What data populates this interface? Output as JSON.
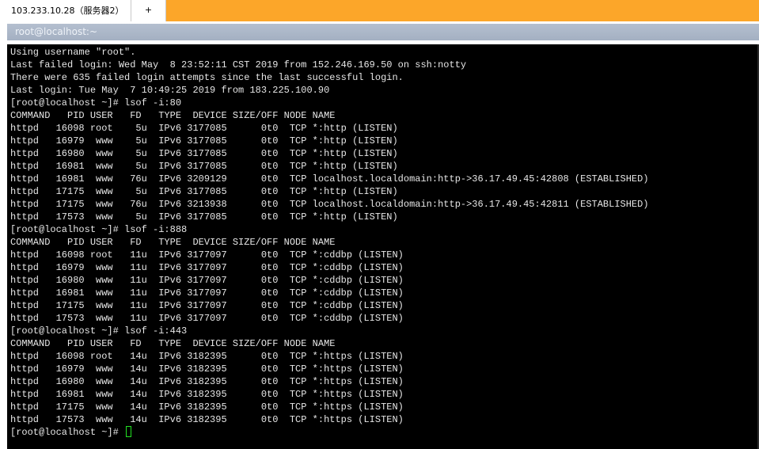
{
  "tabs": {
    "active_label": "103.233.10.28（服务器2）",
    "new_tab_label": "+"
  },
  "window": {
    "title": "root@localhost:~"
  },
  "terminal": {
    "lines": [
      "Using username \"root\".",
      "Last failed login: Wed May  8 23:52:11 CST 2019 from 152.246.169.50 on ssh:notty",
      "There were 635 failed login attempts since the last successful login.",
      "Last login: Tue May  7 10:49:25 2019 from 183.225.100.90",
      "[root@localhost ~]# lsof -i:80",
      "COMMAND   PID USER   FD   TYPE  DEVICE SIZE/OFF NODE NAME",
      "httpd   16098 root    5u  IPv6 3177085      0t0  TCP *:http (LISTEN)",
      "httpd   16979  www    5u  IPv6 3177085      0t0  TCP *:http (LISTEN)",
      "httpd   16980  www    5u  IPv6 3177085      0t0  TCP *:http (LISTEN)",
      "httpd   16981  www    5u  IPv6 3177085      0t0  TCP *:http (LISTEN)",
      "httpd   16981  www   76u  IPv6 3209129      0t0  TCP localhost.localdomain:http->36.17.49.45:42808 (ESTABLISHED)",
      "httpd   17175  www    5u  IPv6 3177085      0t0  TCP *:http (LISTEN)",
      "httpd   17175  www   76u  IPv6 3213938      0t0  TCP localhost.localdomain:http->36.17.49.45:42811 (ESTABLISHED)",
      "httpd   17573  www    5u  IPv6 3177085      0t0  TCP *:http (LISTEN)",
      "[root@localhost ~]# lsof -i:888",
      "COMMAND   PID USER   FD   TYPE  DEVICE SIZE/OFF NODE NAME",
      "httpd   16098 root   11u  IPv6 3177097      0t0  TCP *:cddbp (LISTEN)",
      "httpd   16979  www   11u  IPv6 3177097      0t0  TCP *:cddbp (LISTEN)",
      "httpd   16980  www   11u  IPv6 3177097      0t0  TCP *:cddbp (LISTEN)",
      "httpd   16981  www   11u  IPv6 3177097      0t0  TCP *:cddbp (LISTEN)",
      "httpd   17175  www   11u  IPv6 3177097      0t0  TCP *:cddbp (LISTEN)",
      "httpd   17573  www   11u  IPv6 3177097      0t0  TCP *:cddbp (LISTEN)",
      "[root@localhost ~]# lsof -i:443",
      "COMMAND   PID USER   FD   TYPE  DEVICE SIZE/OFF NODE NAME",
      "httpd   16098 root   14u  IPv6 3182395      0t0  TCP *:https (LISTEN)",
      "httpd   16979  www   14u  IPv6 3182395      0t0  TCP *:https (LISTEN)",
      "httpd   16980  www   14u  IPv6 3182395      0t0  TCP *:https (LISTEN)",
      "httpd   16981  www   14u  IPv6 3182395      0t0  TCP *:https (LISTEN)",
      "httpd   17175  www   14u  IPv6 3182395      0t0  TCP *:https (LISTEN)",
      "httpd   17573  www   14u  IPv6 3182395      0t0  TCP *:https (LISTEN)"
    ],
    "prompt": "[root@localhost ~]# ",
    "cursor_color": "#22e022"
  },
  "colors": {
    "tabbar_background": "#fca629",
    "terminal_background": "#000000",
    "terminal_text": "#e6e6e6",
    "titlebar_background": "#a9b4c6"
  }
}
